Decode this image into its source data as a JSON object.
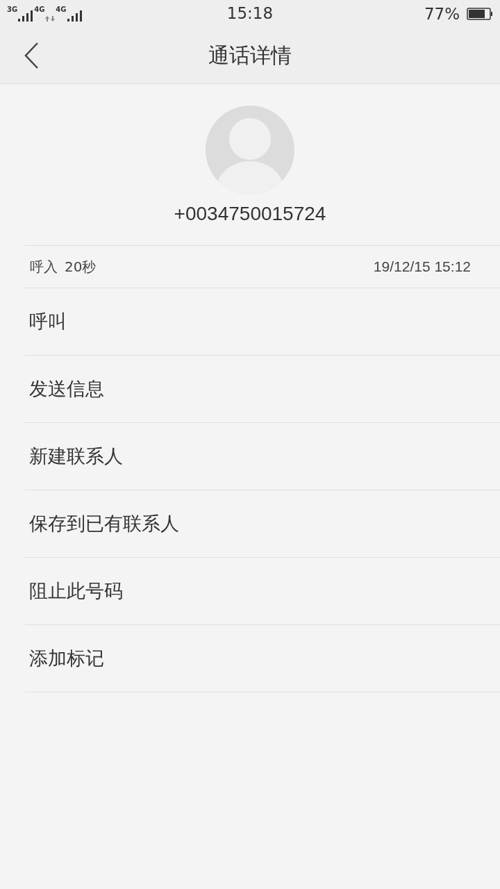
{
  "status_bar": {
    "networks": [
      "3G",
      "4G",
      "4G"
    ],
    "time": "15:18",
    "battery": "77%"
  },
  "header": {
    "title": "通话详情"
  },
  "contact": {
    "number": "+0034750015724"
  },
  "call_log": [
    {
      "direction": "呼入",
      "duration": "20秒",
      "datetime": "19/12/15 15:12"
    }
  ],
  "actions": [
    "呼叫",
    "发送信息",
    "新建联系人",
    "保存到已有联系人",
    "阻止此号码",
    "添加标记"
  ]
}
